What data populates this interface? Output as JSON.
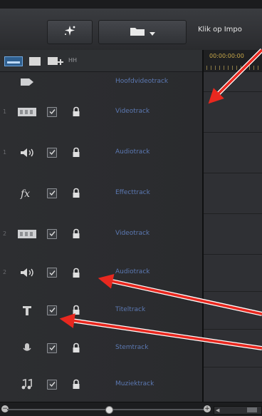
{
  "toolbar": {
    "hint_text": "Klik op Impo"
  },
  "icon_strip": {
    "extra_label": "HH"
  },
  "ruler": {
    "time_text": "00:00:00:00"
  },
  "tracks": [
    {
      "num": "",
      "icon": "film-strip-icon",
      "label": "Hoofdvideotrack"
    },
    {
      "num": "1",
      "icon": "video-track-icon",
      "label": "Videotrack"
    },
    {
      "num": "1",
      "icon": "speaker-icon",
      "label": "Audiotrack"
    },
    {
      "num": "",
      "icon": "fx-icon",
      "label": "Effecttrack"
    },
    {
      "num": "2",
      "icon": "video-track-icon",
      "label": "Videotrack"
    },
    {
      "num": "2",
      "icon": "speaker-icon",
      "label": "Audiotrack"
    },
    {
      "num": "",
      "icon": "title-t-icon",
      "label": "Titeltrack"
    },
    {
      "num": "",
      "icon": "microphone-icon",
      "label": "Stemtrack"
    },
    {
      "num": "",
      "icon": "music-note-icon",
      "label": "Muziektrack"
    }
  ],
  "colors": {
    "label": "#5c79b3",
    "annotation_arrow": "#e8281f",
    "ruler_text": "#c9a94a"
  }
}
